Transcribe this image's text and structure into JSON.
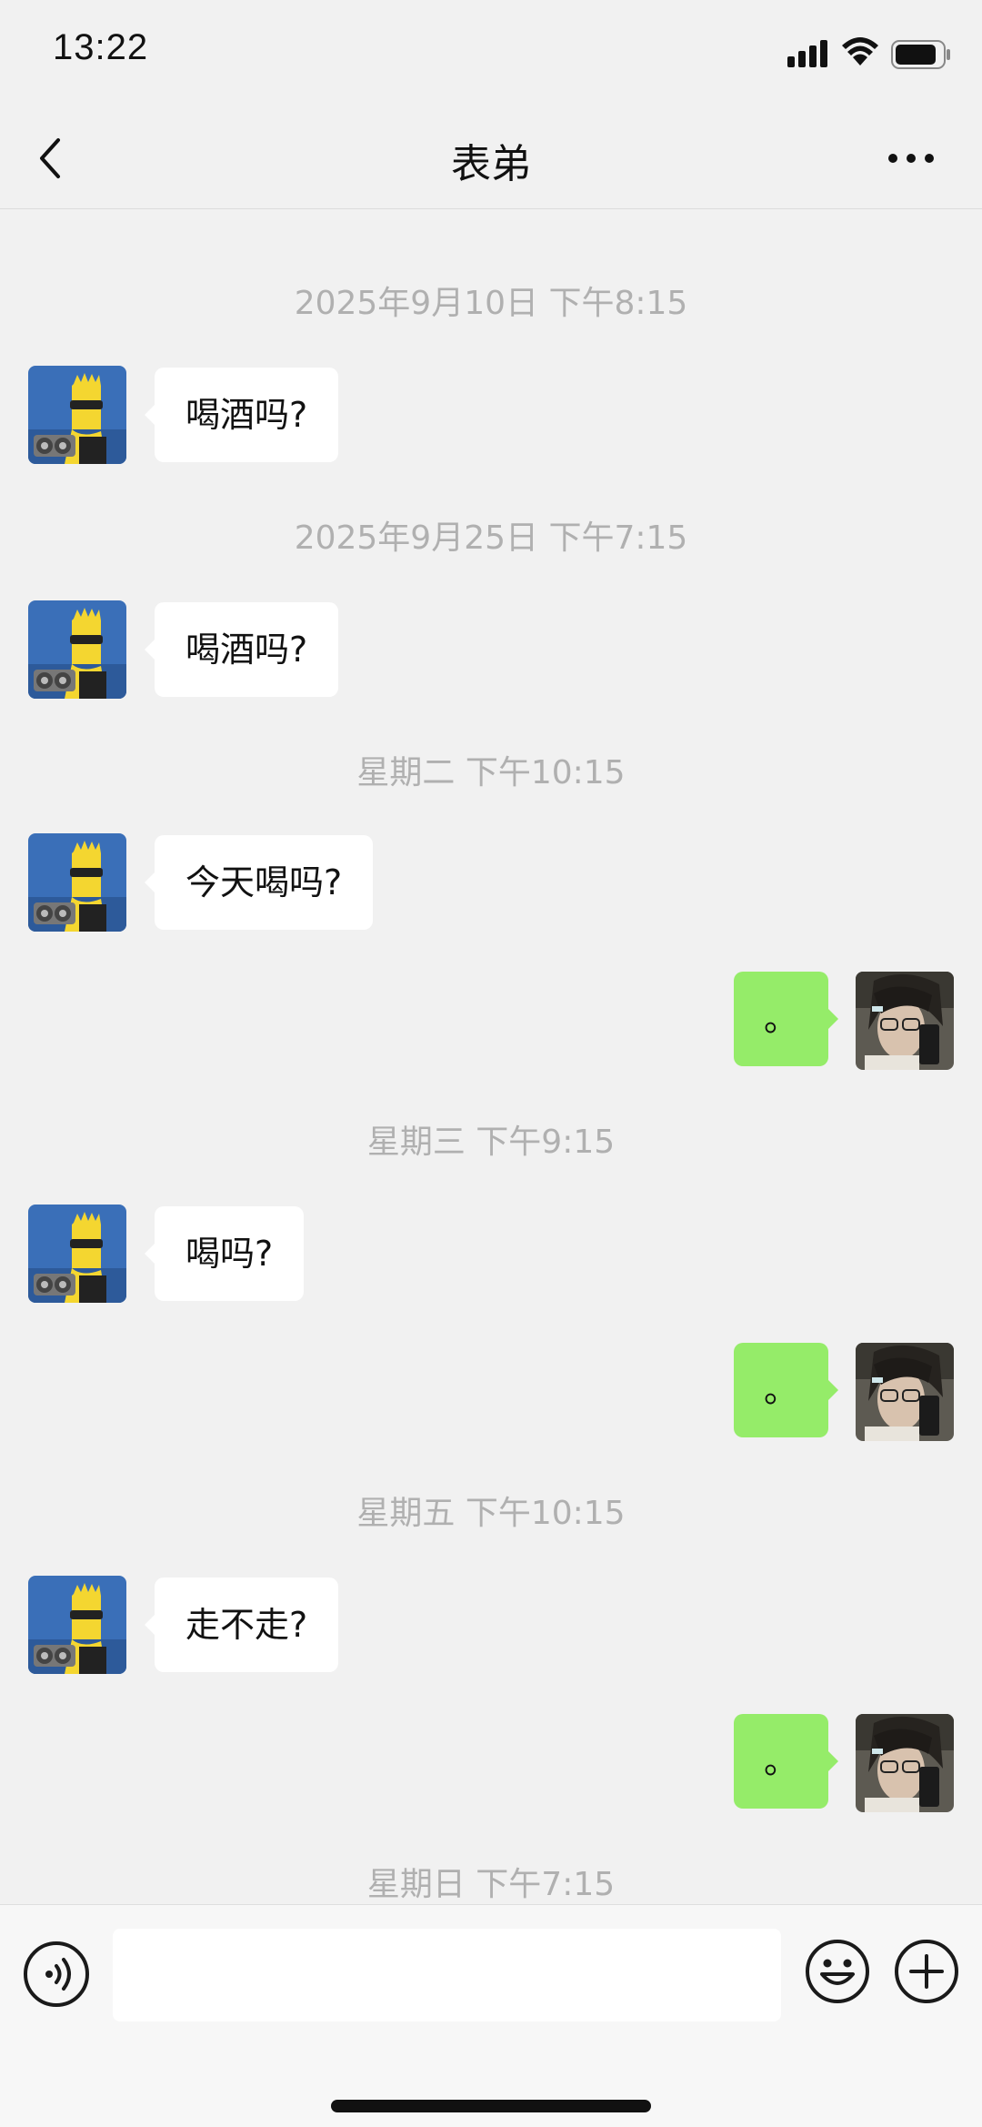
{
  "status_bar": {
    "time": "13:22"
  },
  "nav": {
    "title": "表弟",
    "back_icon": "chevron-left-icon",
    "more_icon": "more-horizontal-icon"
  },
  "chat": {
    "timestamps": [
      "2025年9月10日 下午8:15",
      "2025年9月25日 下午7:15",
      "星期二 下午10:15",
      "星期三 下午9:15",
      "星期五 下午10:15",
      "星期日 下午7:15"
    ],
    "incoming": [
      "喝酒吗?",
      "喝酒吗?",
      "今天喝吗?",
      "喝吗?",
      "走不走?"
    ],
    "outgoing": [
      "。",
      "。",
      "。"
    ]
  },
  "input_bar": {
    "message_value": "",
    "voice_icon": "voice-icon",
    "emoji_icon": "emoji-icon",
    "plus_icon": "plus-circle-icon"
  },
  "colors": {
    "background": "#f1f1f1",
    "incoming_bubble": "#ffffff",
    "outgoing_bubble": "#95ec69",
    "timestamp_text": "#b0b0b0"
  }
}
